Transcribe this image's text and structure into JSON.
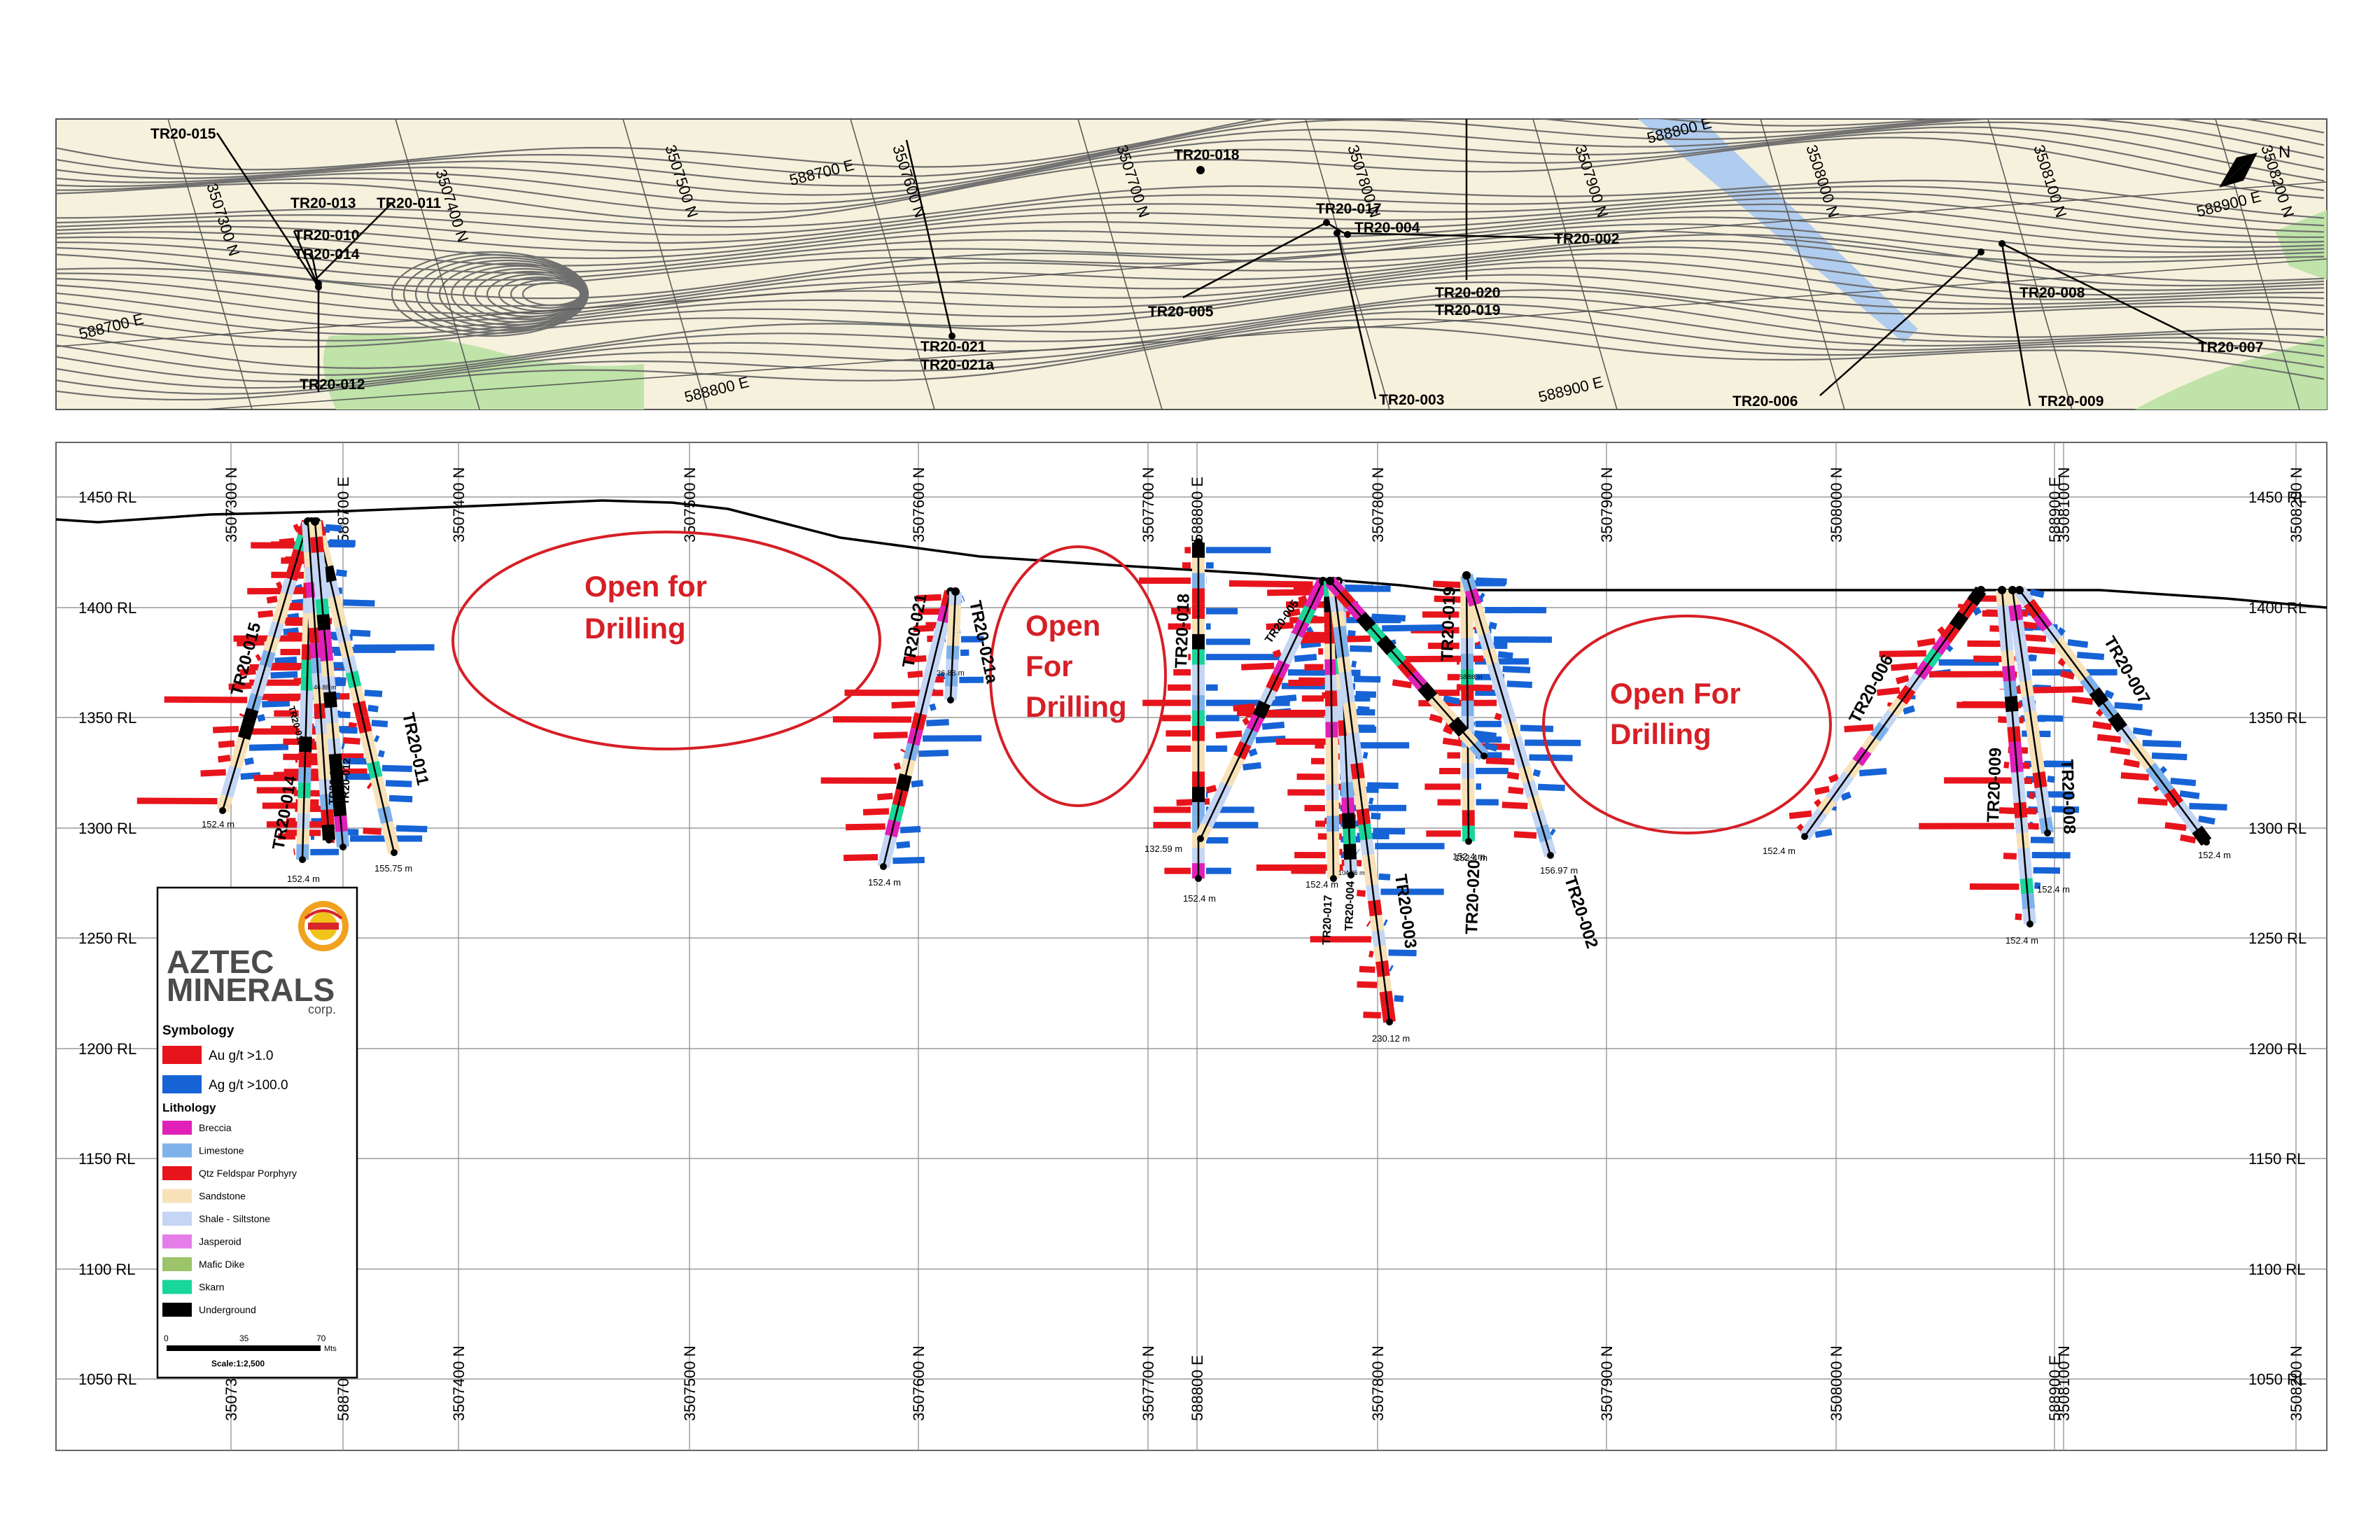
{
  "plan_map": {
    "north_arrow": "north-arrow-icon",
    "north_label": "N",
    "grid_labels": [
      "3507300 N",
      "3507400 N",
      "3507500 N",
      "3507600 N",
      "3507700 N",
      "3507800 N",
      "3507900 N",
      "3508000 N",
      "3508100 N",
      "3508200 N",
      "588700 E",
      "588700 E",
      "588800 E",
      "588800 E",
      "588900 E",
      "588900 E"
    ],
    "drillholes": [
      "TR20-015",
      "TR20-013",
      "TR20-011",
      "TR20-010",
      "TR20-014",
      "TR20-012",
      "TR20-021",
      "TR20-021a",
      "TR20-018",
      "TR20-017",
      "TR20-004",
      "TR20-005",
      "TR20-003",
      "TR20-020",
      "TR20-019",
      "TR20-002",
      "TR20-006",
      "TR20-008",
      "TR20-009",
      "TR20-007"
    ],
    "colors": {
      "background": "#f6f1dc",
      "contour": "#6f6f6f",
      "river": "#a9c8f0",
      "vegetation": "#bfe3a8"
    }
  },
  "section": {
    "rl_labels": [
      "1450 RL",
      "1400 RL",
      "1350 RL",
      "1300 RL",
      "1250 RL",
      "1200 RL",
      "1150 RL",
      "1100 RL",
      "1050 RL"
    ],
    "top_grid_labels": [
      "3507300 N",
      "588700 E",
      "3507400 N",
      "3507500 N",
      "3507600 N",
      "3507700 N",
      "588800 E",
      "3507800 N",
      "3507900 N",
      "3508000 N",
      "588900 E",
      "3508100 N",
      "3508200 N"
    ],
    "bottom_grid_labels": [
      "3507300 N",
      "588700 E",
      "3507400 N",
      "3507500 N",
      "3507600 N",
      "3507700 N",
      "588800 E",
      "3507800 N",
      "3507900 N",
      "3508000 N",
      "588900 E",
      "3508100 N",
      "3508200 N"
    ],
    "open_areas": [
      {
        "line1": "Open for",
        "line2": "Drilling"
      },
      {
        "line1": "Open",
        "line2": "For",
        "line3": "Drilling"
      },
      {
        "line1": "Open For",
        "line2": "Drilling"
      }
    ],
    "depth_labels": [
      "152.4 m",
      "152.4 m",
      "155.75 m",
      "152.4 m",
      "152.4 m",
      "132.59 m",
      "152.4 m",
      "152.4 m",
      "230.12 m",
      "152.4 m",
      "156.97 m",
      "152.4 m",
      "152.4 m",
      "152.4 m",
      "152.4 m"
    ],
    "hole_labels": [
      "TR20-015",
      "TR20-014",
      "TR20-011",
      "TR20-010",
      "TR20-012",
      "TR20-013",
      "TR20-021",
      "TR20-021a",
      "TR20-018",
      "TR20-005",
      "TR20-017",
      "TR20-004",
      "TR20-003",
      "TR20-019",
      "TR20-020",
      "TR20-002",
      "TR20-006",
      "TR20-009",
      "TR20-008",
      "TR20-007"
    ],
    "small_labels": [
      "36.88 m",
      "46.88 m",
      "104.96 m",
      "58.88 m"
    ]
  },
  "legend": {
    "logo_line1": "AZTEC",
    "logo_line2": "MINERALS",
    "logo_line3": "corp.",
    "symbology_title": "Symbology",
    "symbology": [
      {
        "label": "Au g/t >1.0",
        "color": "#e8141c"
      },
      {
        "label": "Ag g/t >100.0",
        "color": "#1663d6"
      }
    ],
    "lithology_title": "Lithology",
    "lithology": [
      {
        "label": "Breccia",
        "color": "#e020b8"
      },
      {
        "label": "Limestone",
        "color": "#7fb2ea"
      },
      {
        "label": "Qtz Feldspar Porphyry",
        "color": "#e8141c"
      },
      {
        "label": "Sandstone",
        "color": "#f7e2b8"
      },
      {
        "label": "Shale - Siltstone",
        "color": "#c4d6f4"
      },
      {
        "label": "Jasperoid",
        "color": "#e57de8"
      },
      {
        "label": "Mafic Dike",
        "color": "#9cc46a"
      },
      {
        "label": "Skarn",
        "color": "#19d69a"
      },
      {
        "label": "Underground",
        "color": "#000000"
      }
    ],
    "scale_ticks": [
      "0",
      "35",
      "70"
    ],
    "scale_unit": "Mts",
    "scale_text": "Scale:1:2,500"
  }
}
